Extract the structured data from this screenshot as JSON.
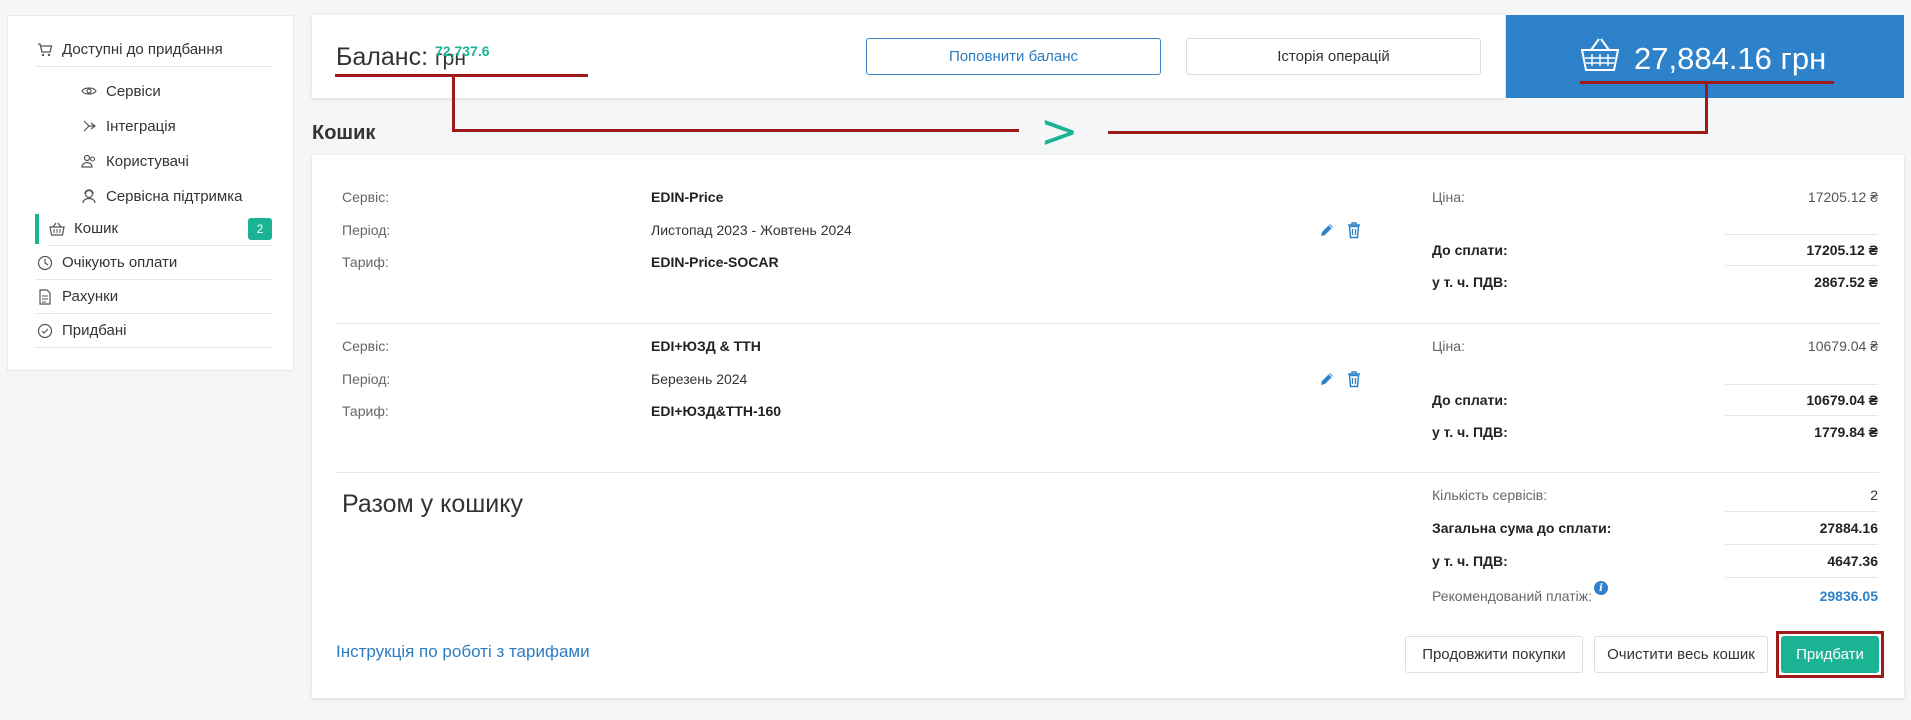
{
  "sidebar": {
    "items": [
      {
        "label": "Доступні до придбання",
        "icon": "cart-icon"
      },
      {
        "label": "Сервіси",
        "icon": "eye-icon"
      },
      {
        "label": "Інтеграція",
        "icon": "integration-icon"
      },
      {
        "label": "Користувачі",
        "icon": "users-icon"
      },
      {
        "label": "Сервісна підтримка",
        "icon": "support-icon"
      },
      {
        "label": "Кошик",
        "icon": "basket-icon",
        "badge": "2"
      },
      {
        "label": "Очікують оплати",
        "icon": "clock-icon"
      },
      {
        "label": "Рахунки",
        "icon": "document-icon"
      },
      {
        "label": "Придбані",
        "icon": "check-circle-icon"
      }
    ]
  },
  "header": {
    "balance_label": "Баланс: ",
    "balance_value": "72,737.6",
    "balance_currency": " грн",
    "topup_label": "Поповнити баланс",
    "history_label": "Історія операцій",
    "cart_total": "27,884.16 грн"
  },
  "colors": {
    "accent": "#1ab394",
    "primary": "#2d82c9",
    "annotation": "#a01a1a"
  },
  "section_title": "Кошик",
  "cart": {
    "labels": {
      "service": "Сервіс:",
      "period": "Період:",
      "tariff": "Тариф:",
      "price": "Ціна:",
      "to_pay": "До сплати:",
      "vat": "у т. ч. ПДВ:"
    },
    "items": [
      {
        "service": "EDIN-Price",
        "period": "Листопад 2023 - Жовтень 2024",
        "tariff": "EDIN-Price-SOCAR",
        "price": "17205.12 ₴",
        "to_pay": "17205.12 ₴",
        "vat": "2867.52 ₴"
      },
      {
        "service": "EDI+ЮЗД & ТТН",
        "period": "Березень 2024",
        "tariff": "EDI+ЮЗД&ТТН-160",
        "price": "10679.04 ₴",
        "to_pay": "10679.04 ₴",
        "vat": "1779.84 ₴"
      }
    ]
  },
  "summary": {
    "title": "Разом у кошику",
    "count_label": "Кількість сервісів:",
    "count": "2",
    "total_label": "Загальна сума до сплати:",
    "total": "27884.16",
    "vat_label": "у т. ч. ПДВ:",
    "vat": "4647.36",
    "recommended_label": "Рекомендований платіж:",
    "recommended": "29836.05",
    "info_glyph": "i"
  },
  "footer": {
    "instructions_link": "Інструкція по роботі з тарифами",
    "continue_label": "Продовжити покупки",
    "clear_label": "Очистити весь кошик",
    "buy_label": "Придбати"
  },
  "annotation": {
    "arrow_glyph": ">"
  }
}
